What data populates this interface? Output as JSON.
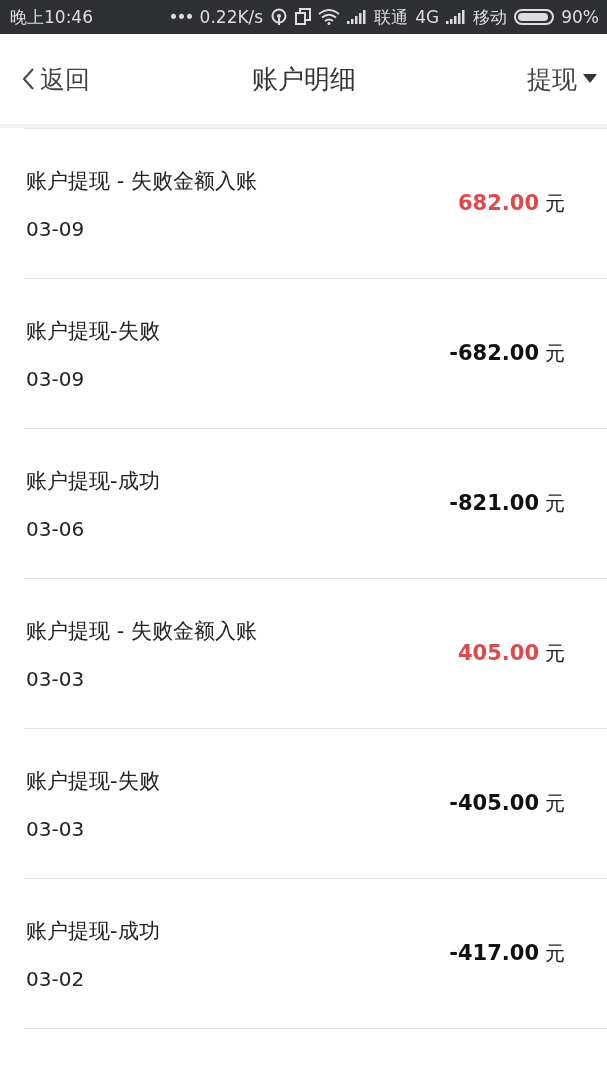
{
  "status_bar": {
    "time": "晚上10:46",
    "dots": "•••",
    "speed": "0.22K/s",
    "carrier_1": "联通",
    "network": "4G",
    "carrier_2": "移动",
    "battery": "90%"
  },
  "header": {
    "back": "返回",
    "title": "账户明细",
    "filter": "提现"
  },
  "records": [
    {
      "title": "账户提现 - 失败金额入账",
      "date": "03-09",
      "amount": "682.00",
      "unit": "元",
      "kind": "income"
    },
    {
      "title": "账户提现-失败",
      "date": "03-09",
      "amount": "-682.00",
      "unit": "元",
      "kind": "expense"
    },
    {
      "title": "账户提现-成功",
      "date": "03-06",
      "amount": "-821.00",
      "unit": "元",
      "kind": "expense"
    },
    {
      "title": "账户提现 - 失败金额入账",
      "date": "03-03",
      "amount": "405.00",
      "unit": "元",
      "kind": "income"
    },
    {
      "title": "账户提现-失败",
      "date": "03-03",
      "amount": "-405.00",
      "unit": "元",
      "kind": "expense"
    },
    {
      "title": "账户提现-成功",
      "date": "03-02",
      "amount": "-417.00",
      "unit": "元",
      "kind": "expense"
    }
  ]
}
